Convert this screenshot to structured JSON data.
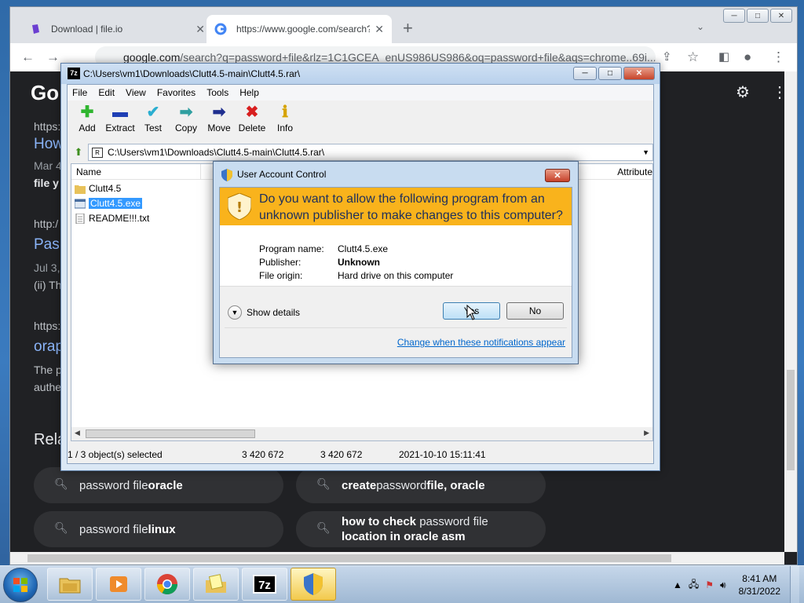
{
  "chrome": {
    "tabs": [
      {
        "title": "Download | file.io",
        "close": "✕"
      },
      {
        "title": "https://www.google.com/search?",
        "close": "✕"
      }
    ],
    "new_tab": "+",
    "tab_search": "⌄",
    "window_buttons": [
      "─",
      "□",
      "✕"
    ],
    "omnibox_host": "google.com",
    "omnibox_path": "/search?q=password+file&rlz=1C1GCEA_enUS986US986&oq=password+file&aqs=chrome..69i...",
    "icons": [
      "back-arrow-icon",
      "forward-arrow-icon",
      "lock-icon",
      "share-icon",
      "star-icon",
      "sidepanel-icon",
      "profile-icon",
      "kebab-menu-icon"
    ]
  },
  "google": {
    "logo": "Go",
    "results": [
      {
        "url": "https:",
        "title": "How",
        "meta": "Mar 4",
        "snippet": "file y"
      },
      {
        "url": "http:/",
        "title": "Pas",
        "meta": "Jul 3,",
        "snippet": "(ii) Th"
      },
      {
        "url": "https:",
        "title": "orap",
        "meta": "The p",
        "snippet": "authe"
      }
    ],
    "related_heading": "Rela",
    "chips": [
      {
        "normal": "password file ",
        "bold": "oracle"
      },
      {
        "bold_pre": "create",
        "normal": " password ",
        "bold": "file, oracle"
      },
      {
        "normal": "password file ",
        "bold": "linux"
      },
      {
        "bold_pre": "how to check",
        "normal": " password file",
        "bold": "location in oracle asm"
      }
    ]
  },
  "sevenzip": {
    "title": "C:\\Users\\vm1\\Downloads\\Clutt4.5-main\\Clutt4.5.rar\\",
    "title_icon": "7z",
    "window_buttons": [
      "─",
      "□",
      "✕"
    ],
    "menu": [
      "File",
      "Edit",
      "View",
      "Favorites",
      "Tools",
      "Help"
    ],
    "tools": [
      {
        "label": "Add",
        "icon": "add-icon",
        "glyph": "✚",
        "color": "#2fb52f"
      },
      {
        "label": "Extract",
        "icon": "extract-icon",
        "glyph": "▬",
        "color": "#1f3fb5"
      },
      {
        "label": "Test",
        "icon": "test-icon",
        "glyph": "✔",
        "color": "#2aaed0"
      },
      {
        "label": "Copy",
        "icon": "copy-icon",
        "glyph": "➡",
        "color": "#2f9fa0"
      },
      {
        "label": "Move",
        "icon": "move-icon",
        "glyph": "➡",
        "color": "#1f2f8f"
      },
      {
        "label": "Delete",
        "icon": "delete-icon",
        "glyph": "✖",
        "color": "#d81f1f"
      },
      {
        "label": "Info",
        "icon": "info-icon",
        "glyph": "ℹ",
        "color": "#d6a300"
      }
    ],
    "path": "C:\\Users\\vm1\\Downloads\\Clutt4.5-main\\Clutt4.5.rar\\",
    "columns": {
      "name": "Name",
      "attributes": "Attribute"
    },
    "files": [
      {
        "name": "Clutt4.5",
        "type": "folder"
      },
      {
        "name": "Clutt4.5.exe",
        "type": "exe",
        "selected": true
      },
      {
        "name": "README!!!.txt",
        "type": "txt"
      }
    ],
    "status": {
      "selected": "1 / 3 object(s) selected",
      "size": "3 420 672",
      "packed": "3 420 672",
      "modified": "2021-10-10 15:11:41"
    }
  },
  "uac": {
    "title": "User Account Control",
    "close": "✕",
    "question": "Do you want to allow the following program from an unknown publisher to make changes to this computer?",
    "program_name_label": "Program name:",
    "program_name": "Clutt4.5.exe",
    "publisher_label": "Publisher:",
    "publisher": "Unknown",
    "file_origin_label": "File origin:",
    "file_origin": "Hard drive on this computer",
    "show_details": "Show details",
    "yes": "Yes",
    "no": "No",
    "link": "Change when these notifications appear"
  },
  "taskbar": {
    "items": [
      "explorer-icon",
      "media-player-icon",
      "chrome-icon",
      "folder-note-icon",
      "sevenzip-icon",
      "uac-shield-icon"
    ],
    "sevenzip_label": "7z",
    "time": "8:41 AM",
    "date": "8/31/2022"
  }
}
